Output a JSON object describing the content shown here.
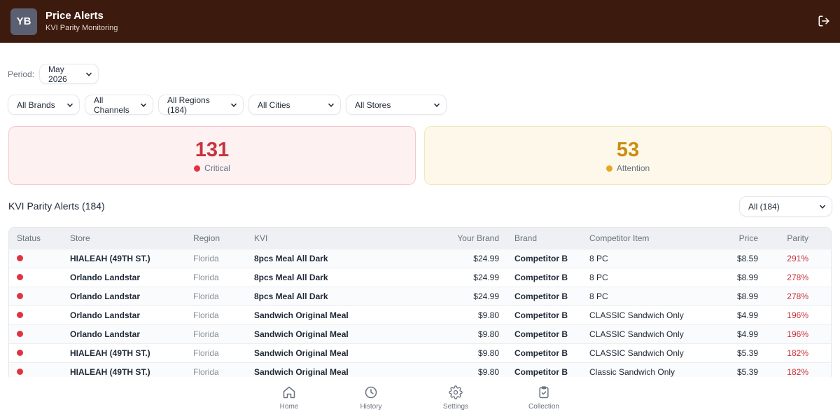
{
  "header": {
    "avatar_initials": "YB",
    "title": "Price Alerts",
    "subtitle": "KVI Parity Monitoring",
    "logout_icon": "logout-icon"
  },
  "period": {
    "label": "Period:",
    "value": "May 2026"
  },
  "filters": {
    "brands": "All Brands",
    "channels": "All Channels",
    "regions": "All Regions (184)",
    "cities": "All Cities",
    "stores": "All Stores"
  },
  "summary": {
    "critical": {
      "count": "131",
      "label": "Critical",
      "color": "#e0323f"
    },
    "attention": {
      "count": "53",
      "label": "Attention",
      "color": "#e8a81c"
    }
  },
  "alerts": {
    "title": "KVI Parity Alerts (184)",
    "filter_value": "All (184)",
    "columns": {
      "status": "Status",
      "store": "Store",
      "region": "Region",
      "kvi": "KVI",
      "your_brand": "Your Brand",
      "brand": "Brand",
      "competitor_item": "Competitor Item",
      "price": "Price",
      "parity": "Parity"
    },
    "rows": [
      {
        "status": "critical",
        "store": "HIALEAH (49TH ST.)",
        "region": "Florida",
        "kvi": "8pcs Meal All Dark",
        "your_brand": "$24.99",
        "brand": "Competitor B",
        "competitor_item": "8 PC",
        "price": "$8.59",
        "parity": "291%"
      },
      {
        "status": "critical",
        "store": "Orlando Landstar",
        "region": "Florida",
        "kvi": "8pcs Meal All Dark",
        "your_brand": "$24.99",
        "brand": "Competitor B",
        "competitor_item": "8 PC",
        "price": "$8.99",
        "parity": "278%"
      },
      {
        "status": "critical",
        "store": "Orlando Landstar",
        "region": "Florida",
        "kvi": "8pcs Meal All Dark",
        "your_brand": "$24.99",
        "brand": "Competitor B",
        "competitor_item": "8 PC",
        "price": "$8.99",
        "parity": "278%"
      },
      {
        "status": "critical",
        "store": "Orlando Landstar",
        "region": "Florida",
        "kvi": "Sandwich Original Meal",
        "your_brand": "$9.80",
        "brand": "Competitor B",
        "competitor_item": "CLASSIC Sandwich Only",
        "price": "$4.99",
        "parity": "196%"
      },
      {
        "status": "critical",
        "store": "Orlando Landstar",
        "region": "Florida",
        "kvi": "Sandwich Original Meal",
        "your_brand": "$9.80",
        "brand": "Competitor B",
        "competitor_item": "CLASSIC Sandwich Only",
        "price": "$4.99",
        "parity": "196%"
      },
      {
        "status": "critical",
        "store": "HIALEAH (49TH ST.)",
        "region": "Florida",
        "kvi": "Sandwich Original Meal",
        "your_brand": "$9.80",
        "brand": "Competitor B",
        "competitor_item": "CLASSIC Sandwich Only",
        "price": "$5.39",
        "parity": "182%"
      },
      {
        "status": "critical",
        "store": "HIALEAH (49TH ST.)",
        "region": "Florida",
        "kvi": "Sandwich Original Meal",
        "your_brand": "$9.80",
        "brand": "Competitor B",
        "competitor_item": "Classic Sandwich Only",
        "price": "$5.39",
        "parity": "182%"
      }
    ]
  },
  "nav": {
    "home": {
      "label": "Home",
      "icon": "home-icon"
    },
    "history": {
      "label": "History",
      "icon": "clock-icon"
    },
    "settings": {
      "label": "Settings",
      "icon": "gear-icon"
    },
    "collection": {
      "label": "Collection",
      "icon": "clipboard-check-icon"
    }
  }
}
